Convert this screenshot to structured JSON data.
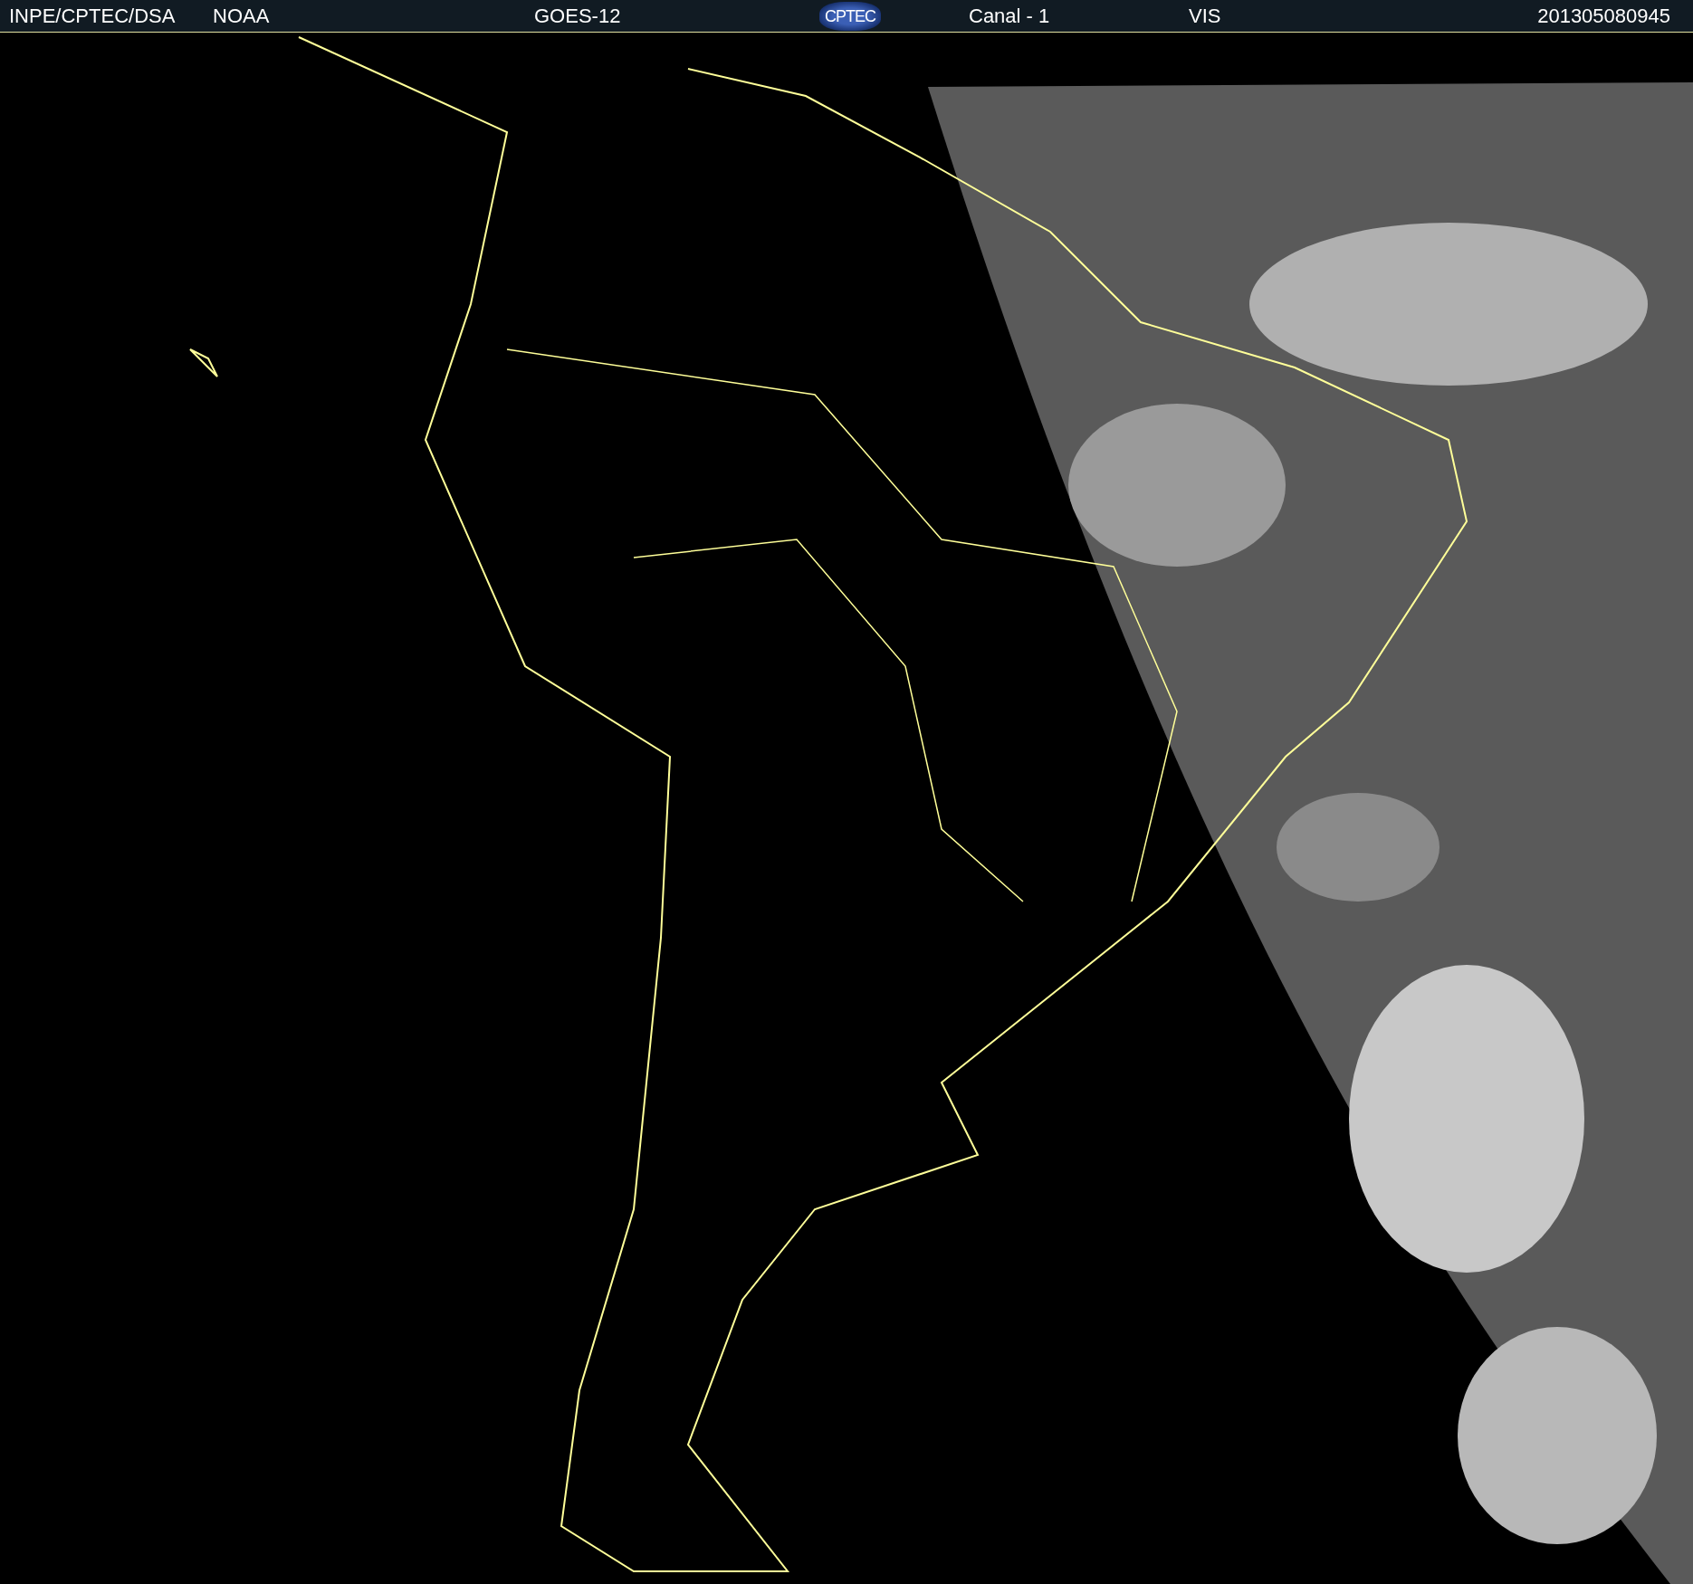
{
  "header": {
    "items": [
      {
        "kind": "text",
        "text": "INPE/CPTEC/DSA"
      },
      {
        "kind": "text",
        "text": "NOAA"
      },
      {
        "kind": "text",
        "text": "GOES-12"
      },
      {
        "kind": "logo",
        "text": "CPTEC"
      },
      {
        "kind": "text",
        "text": "Canal - 1"
      },
      {
        "kind": "text",
        "text": "VIS"
      },
      {
        "kind": "text",
        "text": "201305080945"
      }
    ]
  }
}
